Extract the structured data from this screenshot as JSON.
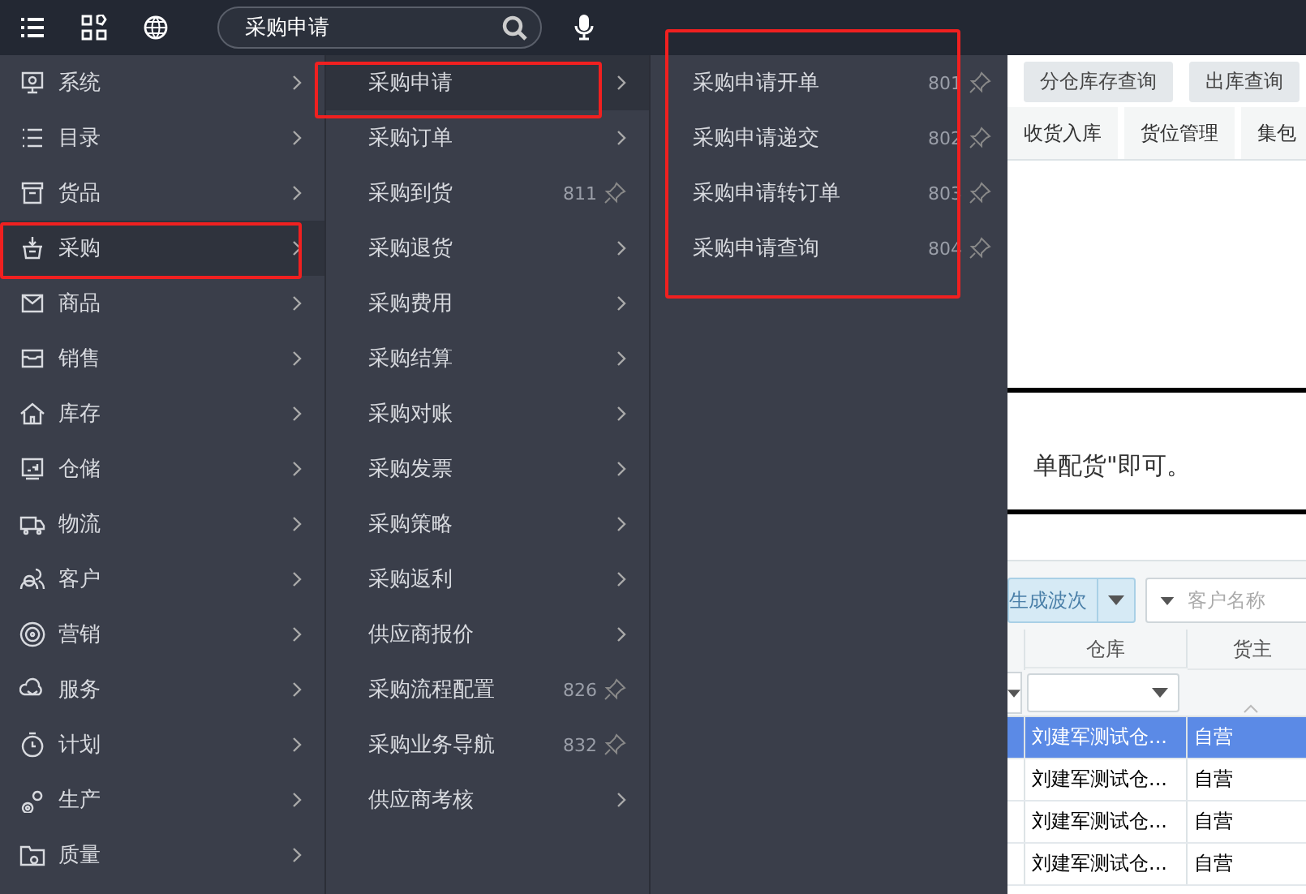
{
  "top_bar": {
    "search": {
      "value": "采购申请"
    }
  },
  "sidebar": {
    "items": [
      {
        "label": "系统",
        "selected": false,
        "annotated": false
      },
      {
        "label": "目录",
        "selected": false,
        "annotated": false
      },
      {
        "label": "货品",
        "selected": false,
        "annotated": false
      },
      {
        "label": "采购",
        "selected": true,
        "annotated": true
      },
      {
        "label": "商品",
        "selected": false,
        "annotated": false
      },
      {
        "label": "销售",
        "selected": false,
        "annotated": false
      },
      {
        "label": "库存",
        "selected": false,
        "annotated": false
      },
      {
        "label": "仓储",
        "selected": false,
        "annotated": false
      },
      {
        "label": "物流",
        "selected": false,
        "annotated": false
      },
      {
        "label": "客户",
        "selected": false,
        "annotated": false
      },
      {
        "label": "营销",
        "selected": false,
        "annotated": false
      },
      {
        "label": "服务",
        "selected": false,
        "annotated": false
      },
      {
        "label": "计划",
        "selected": false,
        "annotated": false
      },
      {
        "label": "生产",
        "selected": false,
        "annotated": false
      },
      {
        "label": "质量",
        "selected": false,
        "annotated": false
      }
    ]
  },
  "submenu": {
    "items": [
      {
        "label": "采购申请",
        "kind": "submenu",
        "selected": true,
        "annotated": true
      },
      {
        "label": "采购订单",
        "kind": "submenu",
        "selected": false,
        "annotated": false
      },
      {
        "label": "采购到货",
        "kind": "pinned",
        "code": "811",
        "selected": false,
        "annotated": false
      },
      {
        "label": "采购退货",
        "kind": "submenu",
        "selected": false,
        "annotated": false
      },
      {
        "label": "采购费用",
        "kind": "submenu",
        "selected": false,
        "annotated": false
      },
      {
        "label": "采购结算",
        "kind": "submenu",
        "selected": false,
        "annotated": false
      },
      {
        "label": "采购对账",
        "kind": "submenu",
        "selected": false,
        "annotated": false
      },
      {
        "label": "采购发票",
        "kind": "submenu",
        "selected": false,
        "annotated": false
      },
      {
        "label": "采购策略",
        "kind": "submenu",
        "selected": false,
        "annotated": false
      },
      {
        "label": "采购返利",
        "kind": "submenu",
        "selected": false,
        "annotated": false
      },
      {
        "label": "供应商报价",
        "kind": "submenu",
        "selected": false,
        "annotated": false
      },
      {
        "label": "采购流程配置",
        "kind": "pinned",
        "code": "826",
        "selected": false,
        "annotated": false
      },
      {
        "label": "采购业务导航",
        "kind": "pinned",
        "code": "832",
        "selected": false,
        "annotated": false
      },
      {
        "label": "供应商考核",
        "kind": "submenu",
        "selected": false,
        "annotated": false
      }
    ]
  },
  "third_menu": {
    "annotated": true,
    "items": [
      {
        "label": "采购申请开单",
        "kind": "pinned",
        "code": "801"
      },
      {
        "label": "采购申请递交",
        "kind": "pinned",
        "code": "802"
      },
      {
        "label": "采购申请转订单",
        "kind": "pinned",
        "code": "803"
      },
      {
        "label": "采购申请查询",
        "kind": "pinned",
        "code": "804"
      }
    ]
  },
  "page": {
    "tabs_row_1": [
      "分仓库存查询",
      "出库查询"
    ],
    "tabs_row_2": [
      "收货入库",
      "货位管理",
      "集包"
    ],
    "note": "单配货\"即可。",
    "toolbar": {
      "split_button": "生成波次",
      "customer_select": {
        "placeholder": "客户名称"
      }
    },
    "table": {
      "columns": [
        "仓库",
        "货主"
      ],
      "rows": [
        {
          "cells": [
            "刘建军测试仓...",
            "自营"
          ],
          "selected": true
        },
        {
          "cells": [
            "刘建军测试仓...",
            "自营"
          ],
          "selected": false
        },
        {
          "cells": [
            "刘建军测试仓...",
            "自营"
          ],
          "selected": false
        },
        {
          "cells": [
            "刘建军测试仓...",
            "自营"
          ],
          "selected": false
        }
      ]
    }
  }
}
